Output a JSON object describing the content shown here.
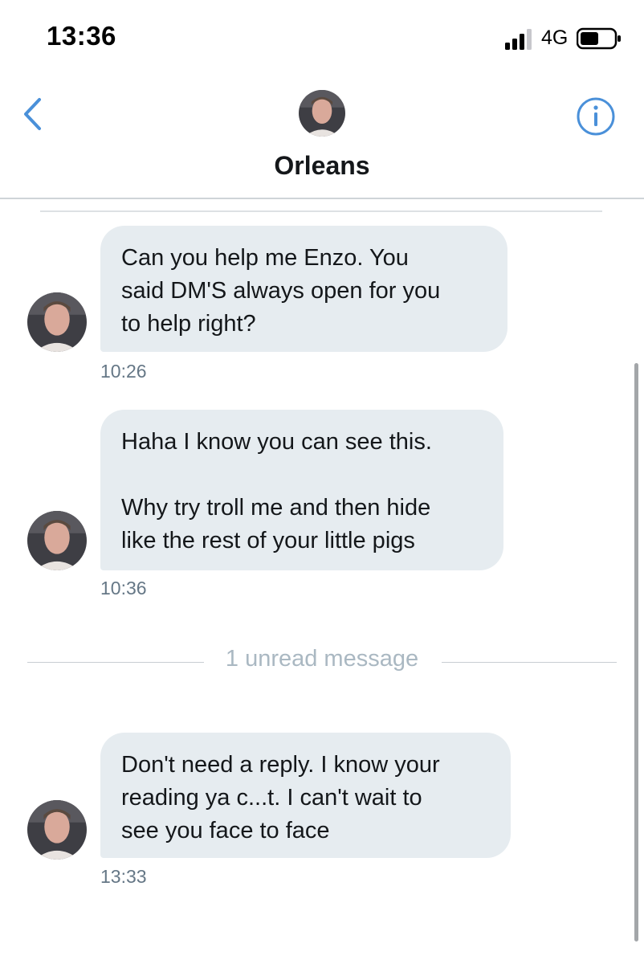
{
  "status_bar": {
    "time": "13:36",
    "network": "4G",
    "icons": [
      "signal-icon",
      "battery-icon"
    ]
  },
  "header": {
    "title": "Orleans",
    "back_icon": "chevron-left-icon",
    "info_icon": "info-icon",
    "accent_color": "#4a90d9"
  },
  "conversation": {
    "messages": [
      {
        "text": "Can you help me Enzo. You\nsaid DM'S always open for you\nto help right?",
        "time": "10:26"
      },
      {
        "text": "Haha I know you can see this.\n\nWhy try troll me and then hide\nlike the rest of your little pigs",
        "time": "10:36"
      },
      {
        "text": "Don't need a reply. I know your\nreading ya c...t.  I can't wait to\nsee you face to face",
        "time": "13:33"
      }
    ],
    "unread_label": "1 unread message",
    "bubble_color": "#e6ecf0"
  }
}
